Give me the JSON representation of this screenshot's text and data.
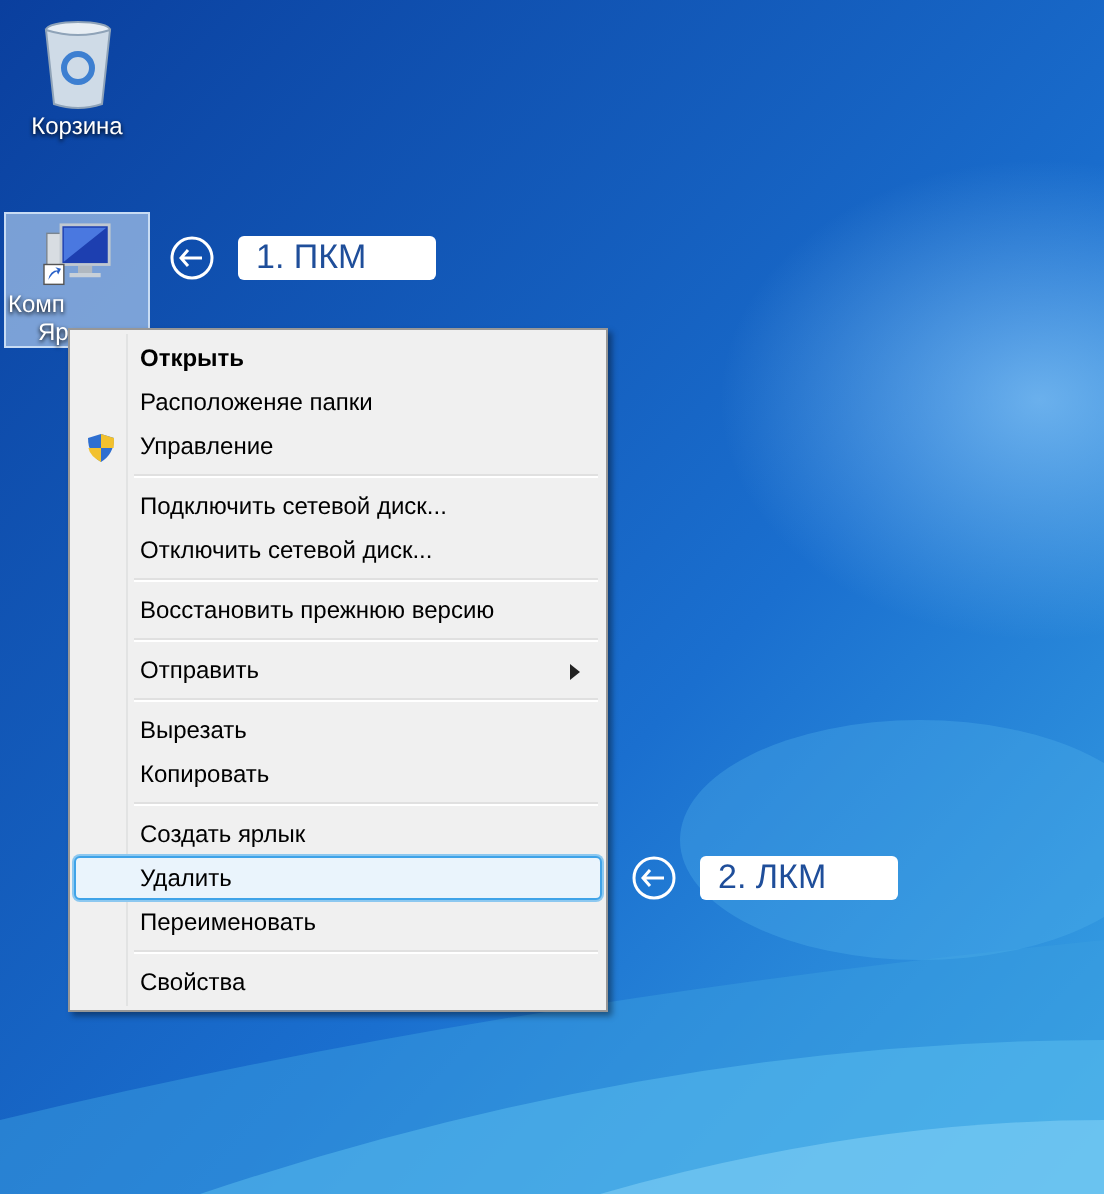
{
  "desktop_icons": [
    {
      "kind": "recycle",
      "lines": [
        "Корзина"
      ],
      "selected": false
    },
    {
      "kind": "computer",
      "lines": [
        "Комп",
        "Яр"
      ],
      "selected": true
    }
  ],
  "callouts": [
    {
      "label": "1. ПКМ"
    },
    {
      "label": "2. ЛКМ"
    }
  ],
  "context_menu": {
    "groups": [
      [
        {
          "label": "Открыть",
          "kind": "plain",
          "bold": true,
          "selected": false
        },
        {
          "label": "Расположеняе папки",
          "kind": "plain",
          "bold": false,
          "selected": false
        },
        {
          "label": "Управление",
          "kind": "shield",
          "bold": false,
          "selected": false
        }
      ],
      [
        {
          "label": "Подключить сетевой диск...",
          "kind": "plain",
          "bold": false,
          "selected": false
        },
        {
          "label": "Отключить сетевой диск...",
          "kind": "plain",
          "bold": false,
          "selected": false
        }
      ],
      [
        {
          "label": "Восстановить прежнюю версию",
          "kind": "plain",
          "bold": false,
          "selected": false
        }
      ],
      [
        {
          "label": "Отправить",
          "kind": "submenu",
          "bold": false,
          "selected": false
        }
      ],
      [
        {
          "label": "Вырезать",
          "kind": "plain",
          "bold": false,
          "selected": false
        },
        {
          "label": "Копировать",
          "kind": "plain",
          "bold": false,
          "selected": false
        }
      ],
      [
        {
          "label": "Создать ярлык",
          "kind": "plain",
          "bold": false,
          "selected": false
        },
        {
          "label": "Удалить",
          "kind": "plain",
          "bold": false,
          "selected": true
        },
        {
          "label": "Переименовать",
          "kind": "plain",
          "bold": false,
          "selected": false
        }
      ],
      [
        {
          "label": "Свойства",
          "kind": "plain",
          "bold": false,
          "selected": false
        }
      ]
    ]
  }
}
